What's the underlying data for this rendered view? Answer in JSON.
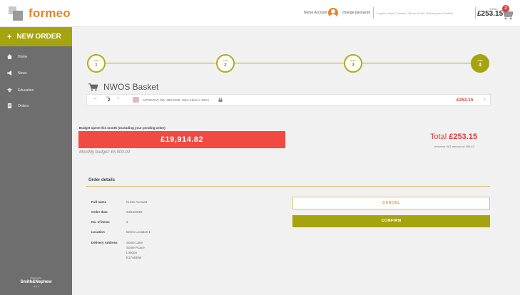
{
  "brand": {
    "name": "formeo"
  },
  "header": {
    "account_name": "Nurse Account",
    "change_password": "change password",
    "links": "Logout  |  Help  |  Contact  |  Terms of Use  |  Privacy and Cookies",
    "total_label": "TOTAL",
    "total_value": "£253.15",
    "cart_count": "2"
  },
  "sidebar": {
    "new_order": "NEW ORDER",
    "items": [
      {
        "label": "Home",
        "icon": "home-icon"
      },
      {
        "label": "News",
        "icon": "megaphone-icon"
      },
      {
        "label": "Education",
        "icon": "graduation-cap-icon"
      },
      {
        "label": "Orders",
        "icon": "document-icon"
      }
    ],
    "powered_by": "Powered by",
    "partner": "Smith&Nephew",
    "version": "v1.4.3"
  },
  "stepper": {
    "steps": [
      {
        "label": "STEP",
        "num": "1"
      },
      {
        "label": "STEP",
        "num": "2"
      },
      {
        "label": "STEP",
        "num": "3"
      },
      {
        "label": "STEP",
        "num": "4"
      }
    ],
    "active_step": 4
  },
  "basket": {
    "title": "NWOS Basket",
    "qty_label": "Qty",
    "qty_value": "2",
    "product": "ACTICOAT, Pip: 292-5782, Size: 10cm x 10cm",
    "price": "£253.15"
  },
  "budget": {
    "label": "Budget spent this month (excluding your pending order)",
    "spent": "£19,914.82",
    "monthly": "Monthly budget: £5,000.00",
    "total_prefix": "Total",
    "total_value": "£253.15",
    "vat": "inclusive VAT amount of £50.63"
  },
  "order": {
    "heading": "Order details",
    "rows": [
      {
        "key": "Full name",
        "value": "Nurse Account"
      },
      {
        "key": "Order date",
        "value": "23/10/2019"
      },
      {
        "key": "No. of items",
        "value": "2"
      },
      {
        "key": "Location",
        "value": "Demo Location 1"
      }
    ],
    "delivery_key": "Delivery Address",
    "delivery_lines": [
      "Some Lane",
      "Some PLace",
      "London",
      "E17AEEW"
    ]
  },
  "actions": {
    "cancel": "CANCEL",
    "confirm": "CONFIRM"
  },
  "colors": {
    "accent": "#a6a40e",
    "brand": "#e8832a",
    "alert": "#f04a43",
    "sidebar": "#6e6e6e"
  }
}
